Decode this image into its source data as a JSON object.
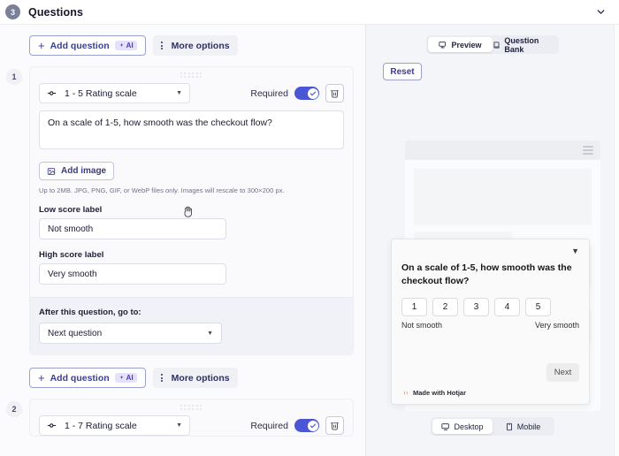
{
  "header": {
    "step": "3",
    "title": "Questions",
    "collapse_icon": "chevron-down-icon"
  },
  "editor": {
    "toolbar_top": {
      "add_question": "Add question",
      "ai_badge": "AI",
      "more_options": "More options"
    },
    "toolbar_bottom": {
      "add_question": "Add question",
      "ai_badge": "AI",
      "more_options": "More options"
    },
    "questions": [
      {
        "number": "1",
        "type": "1 - 5 Rating scale",
        "required_label": "Required",
        "required_on": true,
        "text": "On a scale of 1-5, how smooth was the checkout flow?",
        "add_image": "Add image",
        "image_hint": "Up to 2MB. JPG, PNG, GIF, or WebP files only. Images will rescale to 300×200 px.",
        "low_score_label": "Low score label",
        "low_score_value": "Not smooth",
        "high_score_label": "High score label",
        "high_score_value": "Very smooth",
        "goto_label": "After this question, go to:",
        "goto_value": "Next question"
      },
      {
        "number": "2",
        "type": "1 - 7 Rating scale",
        "required_label": "Required",
        "required_on": true
      }
    ]
  },
  "preview": {
    "tabs": [
      {
        "label": "Preview",
        "icon": "monitor-icon",
        "active": true
      },
      {
        "label": "Question Bank",
        "icon": "book-icon",
        "active": false
      }
    ],
    "reset_button": "Reset",
    "survey": {
      "question": "On a scale of 1-5, how smooth was the checkout flow?",
      "scale": [
        "1",
        "2",
        "3",
        "4",
        "5"
      ],
      "low_label": "Not smooth",
      "high_label": "Very smooth",
      "next_button": "Next",
      "branding": "Made with Hotjar"
    },
    "device_tabs": [
      {
        "label": "Desktop",
        "icon": "monitor-icon",
        "active": true
      },
      {
        "label": "Mobile",
        "icon": "phone-icon",
        "active": false
      }
    ]
  },
  "colors": {
    "accent_indigo": "#4b56d6",
    "link_indigo": "#3c3f8f",
    "ai_badge_bg": "#e4e2fb",
    "hotjar_red": "#e03a2f",
    "panel_bg": "#f4f5f9"
  }
}
